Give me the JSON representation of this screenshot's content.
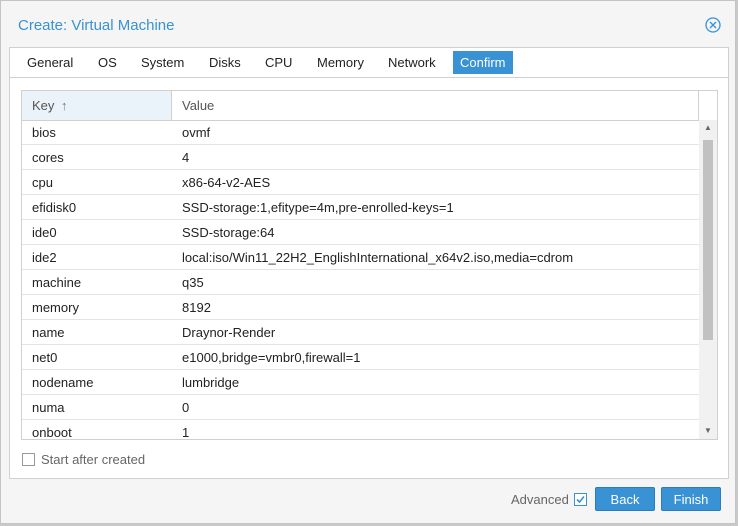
{
  "window": {
    "title": "Create: Virtual Machine"
  },
  "tabs": [
    {
      "label": "General"
    },
    {
      "label": "OS"
    },
    {
      "label": "System"
    },
    {
      "label": "Disks"
    },
    {
      "label": "CPU"
    },
    {
      "label": "Memory"
    },
    {
      "label": "Network"
    },
    {
      "label": "Confirm",
      "active": true
    }
  ],
  "grid": {
    "columns": {
      "key": "Key",
      "value": "Value"
    },
    "sort_icon": "arrow-up-icon",
    "rows": [
      {
        "key": "bios",
        "value": "ovmf"
      },
      {
        "key": "cores",
        "value": "4"
      },
      {
        "key": "cpu",
        "value": "x86-64-v2-AES"
      },
      {
        "key": "efidisk0",
        "value": "SSD-storage:1,efitype=4m,pre-enrolled-keys=1"
      },
      {
        "key": "ide0",
        "value": "SSD-storage:64"
      },
      {
        "key": "ide2",
        "value": "local:iso/Win11_22H2_EnglishInternational_x64v2.iso,media=cdrom"
      },
      {
        "key": "machine",
        "value": "q35"
      },
      {
        "key": "memory",
        "value": "8192"
      },
      {
        "key": "name",
        "value": "Draynor-Render"
      },
      {
        "key": "net0",
        "value": "e1000,bridge=vmbr0,firewall=1"
      },
      {
        "key": "nodename",
        "value": "lumbridge"
      },
      {
        "key": "numa",
        "value": "0"
      },
      {
        "key": "onboot",
        "value": "1"
      }
    ]
  },
  "start_after_created": {
    "label": "Start after created",
    "checked": false
  },
  "footer": {
    "advanced_label": "Advanced",
    "advanced_checked": true,
    "back_label": "Back",
    "finish_label": "Finish"
  },
  "colors": {
    "accent": "#3892d4",
    "header_sorted_bg": "#ebf3fa"
  }
}
